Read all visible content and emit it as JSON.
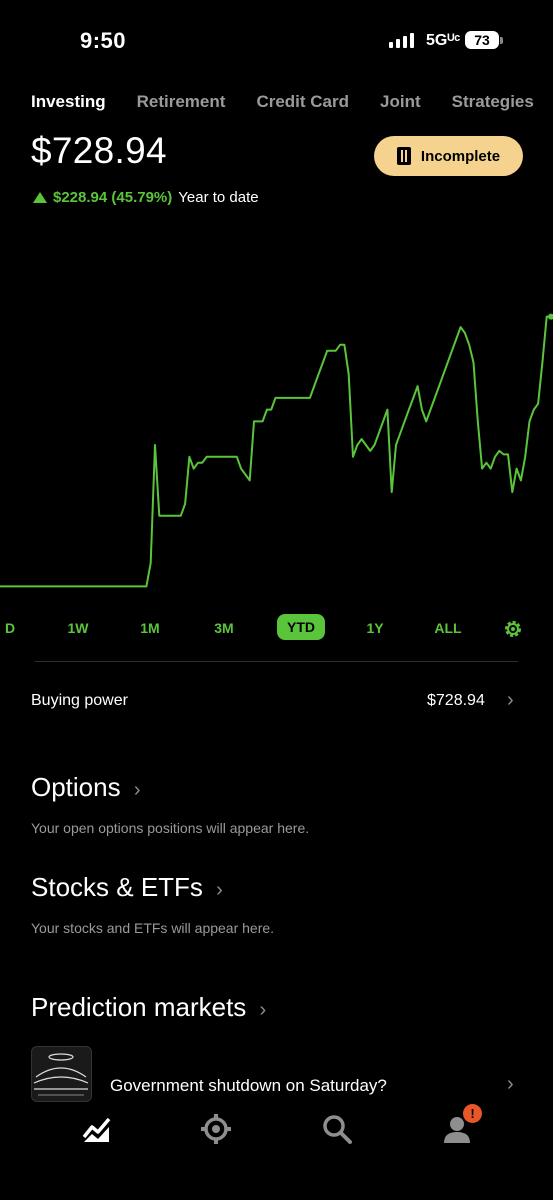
{
  "status_bar": {
    "time": "9:50",
    "network": "5Gᵁᶜ",
    "battery": "73"
  },
  "tabs": [
    {
      "label": "Investing",
      "active": true
    },
    {
      "label": "Retirement",
      "active": false
    },
    {
      "label": "Credit Card",
      "active": false
    },
    {
      "label": "Joint",
      "active": false
    },
    {
      "label": "Strategies",
      "active": false
    }
  ],
  "portfolio": {
    "value": "$728.94",
    "change": "$228.94 (45.79%)",
    "period": "Year to date",
    "status_button": "Incomplete",
    "accent": "#5ac53b"
  },
  "chart_data": {
    "type": "line",
    "series": [
      {
        "values": [
          500,
          500,
          500,
          500,
          500,
          500,
          500,
          500,
          500,
          500,
          500,
          500,
          500,
          500,
          500,
          500,
          500,
          500,
          500,
          500,
          500,
          500,
          500,
          500,
          500,
          500,
          500,
          500,
          500,
          500,
          500,
          500,
          500,
          500,
          500,
          520,
          620,
          560,
          560,
          560,
          560,
          560,
          560,
          570,
          610,
          600,
          605,
          605,
          610,
          610,
          610,
          610,
          610,
          610,
          610,
          610,
          600,
          595,
          590,
          640,
          640,
          640,
          650,
          650,
          660,
          660,
          660,
          660,
          660,
          660,
          660,
          660,
          660,
          670,
          680,
          690,
          700,
          700,
          700,
          705,
          705,
          680,
          610,
          620,
          625,
          620,
          615,
          620,
          630,
          640,
          650,
          580,
          620,
          630,
          640,
          650,
          660,
          670,
          650,
          640,
          650,
          660,
          670,
          680,
          690,
          700,
          710,
          720,
          715,
          705,
          690,
          640,
          600,
          605,
          600,
          610,
          615,
          612,
          612,
          580,
          600,
          590,
          610,
          640,
          650,
          655,
          690,
          728.94,
          728.94
        ]
      }
    ],
    "ylim": [
      480,
      760
    ],
    "grid": false
  },
  "ranges": {
    "items": [
      "D",
      "1W",
      "1M",
      "3M",
      "YTD",
      "1Y",
      "ALL"
    ],
    "selected": "YTD"
  },
  "buying_power": {
    "label": "Buying power",
    "value": "$728.94"
  },
  "options": {
    "title": "Options",
    "subtitle": "Your open options positions will appear here."
  },
  "stocks": {
    "title": "Stocks & ETFs",
    "subtitle": "Your stocks and ETFs will appear here."
  },
  "prediction": {
    "title": "Prediction markets",
    "item": "Government shutdown on Saturday?"
  },
  "bottom_nav": {
    "icons": [
      "chart-icon",
      "crypto-icon",
      "search-icon",
      "account-icon"
    ],
    "badge": "!"
  }
}
